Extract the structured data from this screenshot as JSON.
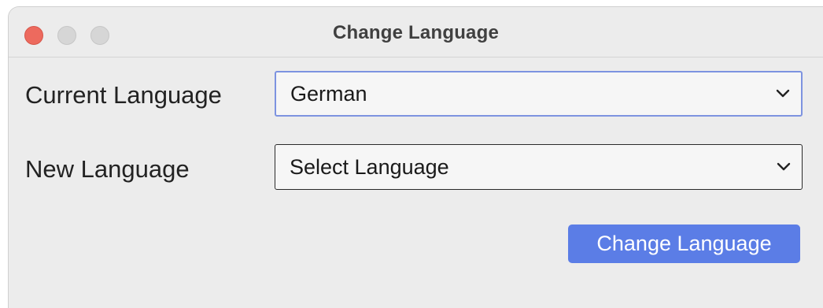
{
  "window": {
    "title": "Change Language"
  },
  "form": {
    "current_language_label": "Current Language",
    "current_language_value": "German",
    "new_language_label": "New Language",
    "new_language_value": "Select Language"
  },
  "actions": {
    "change_language_label": "Change Language"
  },
  "icons": {
    "close": "close-icon",
    "minimize": "minimize-icon",
    "maximize": "maximize-icon",
    "dropdown": "chevron-down-icon"
  },
  "colors": {
    "accent": "#5b7de6",
    "focus_border": "#7d93e0",
    "close_button": "#ed6a5e"
  }
}
